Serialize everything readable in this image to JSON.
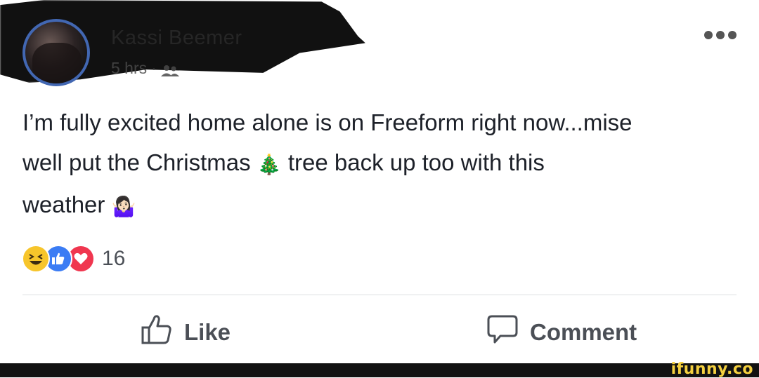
{
  "post": {
    "author": "Kassi Beemer",
    "time": "5 hrs",
    "separator": "·",
    "text_line1": "I’m fully excited home alone is on Freeform right now...mise",
    "text_line2_a": "well put the Christmas",
    "emoji_tree": "🎄",
    "text_line2_b": "tree back up too with this",
    "text_line3": "weather",
    "emoji_shrug": "🤷🏻‍♀️"
  },
  "reactions": {
    "count": "16",
    "types": [
      "haha",
      "like",
      "love"
    ]
  },
  "actions": {
    "like_label": "Like",
    "comment_label": "Comment"
  },
  "watermark": {
    "text": "ifunny.co"
  },
  "colors": {
    "accent": "#4267b2",
    "text": "#1d2129",
    "muted": "#4b4f56"
  }
}
